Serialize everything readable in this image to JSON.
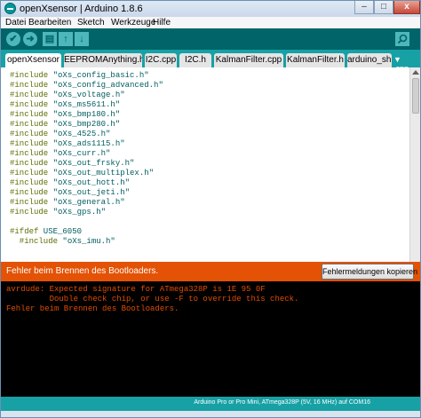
{
  "window": {
    "title": "openXsensor | Arduino 1.8.6",
    "controls": {
      "minimize": "–",
      "maximize": "□",
      "close": "x"
    }
  },
  "menu": [
    "Datei",
    "Bearbeiten",
    "Sketch",
    "Werkzeuge",
    "Hilfe"
  ],
  "toolbar": {
    "buttons": [
      {
        "name": "verify",
        "glyph": "✔"
      },
      {
        "name": "upload",
        "glyph": "➜"
      },
      {
        "name": "new",
        "glyph": "▤"
      },
      {
        "name": "open",
        "glyph": "↑"
      },
      {
        "name": "save",
        "glyph": "↓"
      }
    ],
    "serial_monitor_icon": "magnifier-icon"
  },
  "tabs": [
    {
      "label": "openXsensor",
      "active": true
    },
    {
      "label": "EEPROMAnything.h",
      "active": false
    },
    {
      "label": "I2C.cpp",
      "active": false
    },
    {
      "label": "I2C.h",
      "active": false
    },
    {
      "label": "KalmanFilter.cpp",
      "active": false
    },
    {
      "label": "KalmanFilter.h",
      "active": false
    },
    {
      "label": "arduino_shi",
      "active": false
    }
  ],
  "tab_overflow": "▼ .cpp",
  "code": [
    {
      "kw": "#include",
      "str": " \"oXs_config_basic.h\""
    },
    {
      "kw": "#include",
      "str": " \"oXs_config_advanced.h\""
    },
    {
      "kw": "#include",
      "str": " \"oXs_voltage.h\""
    },
    {
      "kw": "#include",
      "str": " \"oXs_ms5611.h\""
    },
    {
      "kw": "#include",
      "str": " \"oXs_bmp180.h\""
    },
    {
      "kw": "#include",
      "str": " \"oXs_bmp280.h\""
    },
    {
      "kw": "#include",
      "str": " \"oXs_4525.h\""
    },
    {
      "kw": "#include",
      "str": " \"oXs_ads1115.h\""
    },
    {
      "kw": "#include",
      "str": " \"oXs_curr.h\""
    },
    {
      "kw": "#include",
      "str": " \"oXs_out_frsky.h\""
    },
    {
      "kw": "#include",
      "str": " \"oXs_out_multiplex.h\""
    },
    {
      "kw": "#include",
      "str": " \"oXs_out_hott.h\""
    },
    {
      "kw": "#include",
      "str": " \"oXs_out_jeti.h\""
    },
    {
      "kw": "#include",
      "str": " \"oXs_general.h\""
    },
    {
      "kw": "#include",
      "str": " \"oXs_gps.h\""
    },
    {
      "kw": "",
      "str": ""
    },
    {
      "kw": "#ifdef",
      "str": " USE_6050"
    },
    {
      "kw": "  #include",
      "str": " \"oXs_imu.h\""
    }
  ],
  "status": {
    "message": "Fehler beim Brennen des Bootloaders.",
    "copy_button": "Fehlermeldungen kopieren"
  },
  "console": [
    "avrdude: Expected signature for ATmega328P is 1E 95 0F",
    "         Double check chip, or use -F to override this check.",
    "Fehler beim Brennen des Bootloaders."
  ],
  "footer": {
    "board_info": "Arduino Pro or Pro Mini, ATmega328P (5V, 16 MHz) auf COM16"
  },
  "colors": {
    "toolbar": "#006468",
    "tabbar": "#17a1a5",
    "error": "#e35205",
    "console_bg": "#000000",
    "console_text": "#e34c00"
  }
}
